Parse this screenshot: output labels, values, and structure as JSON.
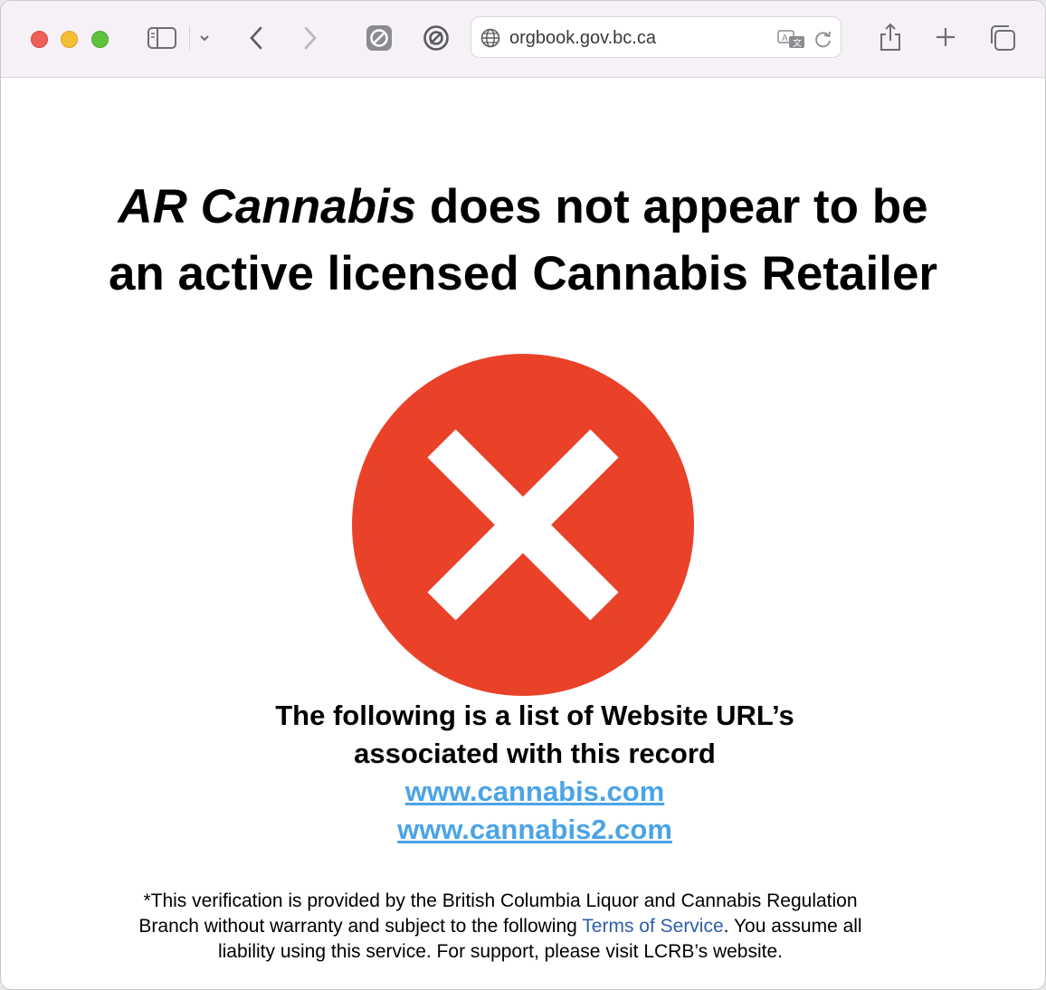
{
  "browser": {
    "url": "orgbook.gov.bc.ca",
    "icons": [
      "sidebar-icon",
      "chevron-down-icon",
      "back-icon",
      "forward-icon",
      "blocker-icon",
      "privacy-icon",
      "globe-icon",
      "translate-icon",
      "reload-icon",
      "share-icon",
      "new-tab-icon",
      "tab-overview-icon"
    ]
  },
  "page": {
    "title_italic": "AR Cannabis",
    "title_rest_line1": " does not appear to be",
    "title_line2": "an active licensed Cannabis Retailer",
    "status_color": "#ea4129",
    "urls_heading_line1": "The following is a list of Website URL’s",
    "urls_heading_line2": "associated with this record",
    "urls": [
      "www.cannabis.com",
      "www.cannabis2.com"
    ],
    "footer_line1": "*This verification is provided by the British Columbia Liquor and Cannabis Regulation",
    "footer_line2_pre": "Branch without warranty and subject to the following ",
    "footer_link": "Terms of Service",
    "footer_line2_post": ". You assume all",
    "footer_line3": "liability using this service. For support, please visit LCRB’s website."
  }
}
